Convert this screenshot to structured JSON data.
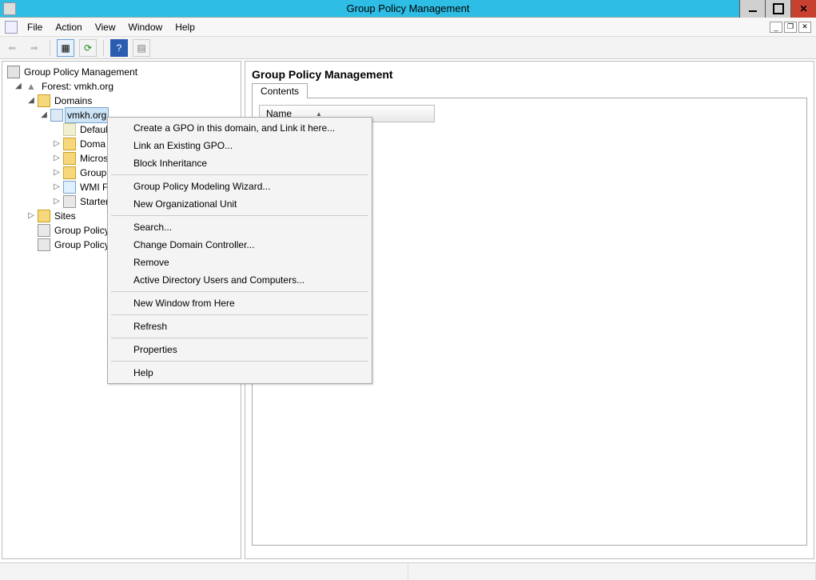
{
  "window": {
    "title": "Group Policy Management"
  },
  "menu": {
    "file": "File",
    "action": "Action",
    "view": "View",
    "window": "Window",
    "help": "Help"
  },
  "tree": {
    "root": "Group Policy Management",
    "forest": "Forest: vmkh.org",
    "domains": "Domains",
    "domain": "vmkh.org",
    "default": "Defaul",
    "domaincontrollers": "Doma",
    "microsoft": "Micros",
    "gpos": "Group",
    "wmi": "WMI F",
    "starter": "Starter",
    "sites": "Sites",
    "modeling": "Group Policy",
    "results": "Group Policy"
  },
  "content": {
    "title": "Group Policy Management",
    "tab": "Contents",
    "column": "Name"
  },
  "context": {
    "items": [
      "Create a GPO in this domain, and Link it here...",
      "Link an Existing GPO...",
      "Block Inheritance",
      "-",
      "Group Policy Modeling Wizard...",
      "New Organizational Unit",
      "-",
      "Search...",
      "Change Domain Controller...",
      "Remove",
      "Active Directory Users and Computers...",
      "-",
      "New Window from Here",
      "-",
      "Refresh",
      "-",
      "Properties",
      "-",
      "Help"
    ]
  }
}
